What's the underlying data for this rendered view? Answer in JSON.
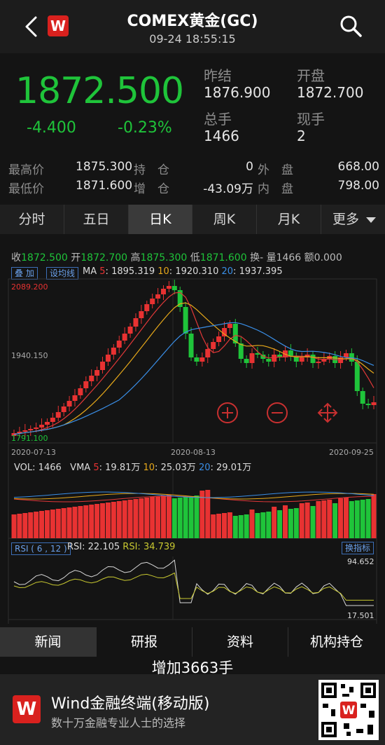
{
  "header": {
    "title": "COMEX黄金(GC)",
    "datetime": "09-24 18:55:15",
    "logo": "W"
  },
  "quote": {
    "price": "1872.500",
    "change": "-4.400",
    "change_pct": "-0.23%",
    "prev_close_label": "昨结",
    "prev_close": "1876.900",
    "open_label": "开盘",
    "open": "1872.700",
    "volume_label": "总手",
    "volume": "1466",
    "current_label": "现手",
    "current": "2"
  },
  "stats": {
    "high_label": "最高价",
    "high": "1875.300",
    "low_label": "最低价",
    "low": "1871.600",
    "oi_label": "持　仓",
    "oi": "0",
    "oi_change_label": "增　仓",
    "oi_change": "-43.09万",
    "outer_label": "外　盘",
    "outer": "668.00",
    "inner_label": "内　盘",
    "inner": "798.00"
  },
  "period_tabs": [
    "分时",
    "五日",
    "日K",
    "周K",
    "月K",
    "更多"
  ],
  "active_period": 2,
  "chart_info": {
    "close_label": "收",
    "close": "1872.500",
    "open_label": "开",
    "open": "1872.700",
    "high_label": "高",
    "high": "1875.300",
    "low_label": "低",
    "low": "1871.600",
    "turnover_label": "换",
    "turnover": "-",
    "vol_label": "量",
    "vol": "1466",
    "amount_label": "额",
    "amount": "0.000",
    "tag_adjust": "叠 加",
    "tag_ma": "设均线",
    "ma_label": "MA",
    "ma5_label": "5",
    "ma5": "1895.319",
    "ma10_label": "10",
    "ma10": "1920.310",
    "ma20_label": "20",
    "ma20": "1937.395",
    "axis_top": "2089.200",
    "axis_mid": "1940.150",
    "axis_bot": "1791.100",
    "date_1": "2020-07-13",
    "date_2": "2020-08-13",
    "date_3": "2020-09-25",
    "vol_row_label": "VOL",
    "vol_row": "1466",
    "vma_label": "VMA",
    "vma5_label": "5",
    "vma5": "19.81万",
    "vma10_label": "10",
    "vma10": "25.03万",
    "vma20_label": "20",
    "vma20": "29.01万",
    "rsi_tag": "RSI ( 6 , 12 )",
    "rsi1_label": "RSI",
    "rsi1": "22.105",
    "rsi2_label": "RSI",
    "rsi2": "34.739",
    "indicator_button": "换指标",
    "rsi_top": "94.652",
    "rsi_bot": "17.501"
  },
  "news_tabs": [
    "新闻",
    "研报",
    "资料",
    "机构持仓"
  ],
  "active_news": 0,
  "news_line": "增加3663手",
  "banner": {
    "title": "Wind金融终端(移动版)",
    "subtitle": "数十万金融专业人士的选择"
  },
  "colors": {
    "up": "#e83232",
    "down": "#1fc43a",
    "ma5": "#e03838",
    "ma10": "#e6a81a",
    "ma20": "#3a8ee6",
    "rsi1": "#d8d8d8",
    "rsi2": "#c8c830"
  },
  "icons": {
    "back": "chevron-left-icon",
    "search": "search-icon",
    "zoom_in": "zoom-in-icon",
    "zoom_out": "zoom-out-icon",
    "move": "move-icon",
    "more": "caret-down-icon"
  }
}
